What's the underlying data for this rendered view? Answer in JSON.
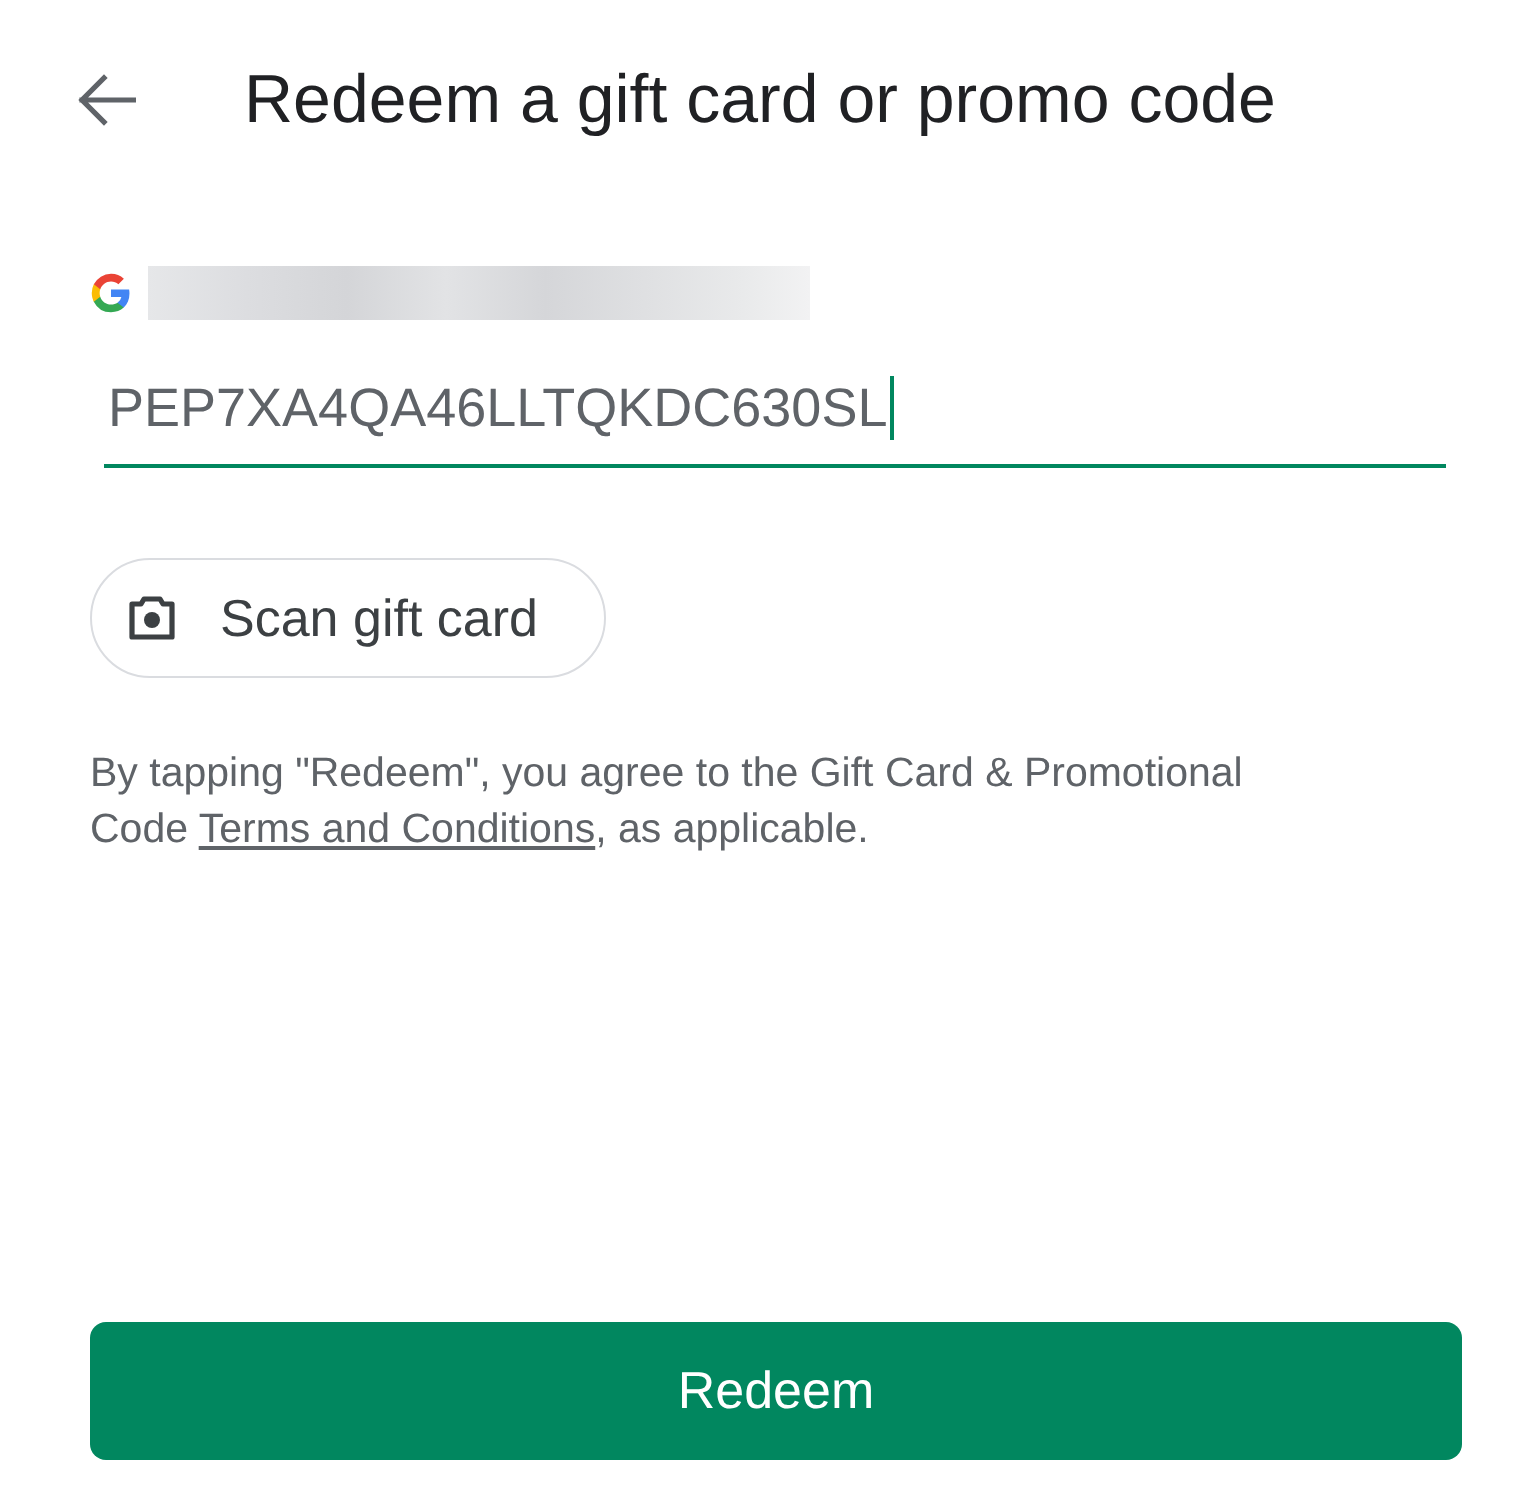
{
  "header": {
    "title": "Redeem a gift card or promo code"
  },
  "code_field": {
    "value": "PEP7XA4QA46LLTQKDC630SL",
    "focused": true
  },
  "scan_button": {
    "label": "Scan gift card"
  },
  "terms": {
    "before": "By tapping \"Redeem\", you agree to the Gift Card & Promotional Code ",
    "link": "Terms and Conditions",
    "after": ", as applicable."
  },
  "redeem_button": {
    "label": "Redeem"
  }
}
